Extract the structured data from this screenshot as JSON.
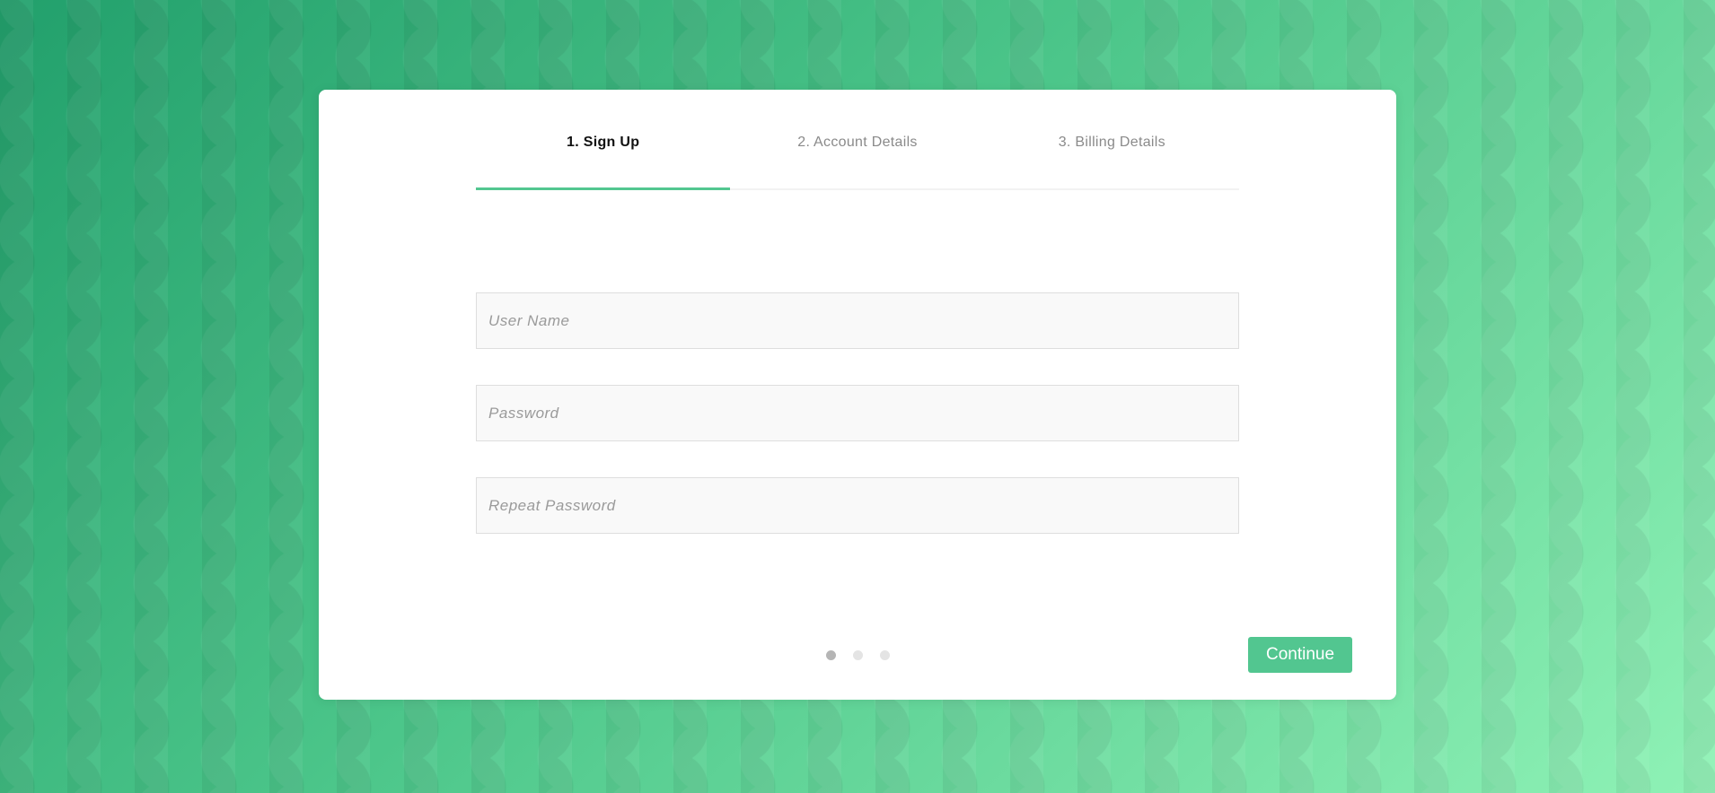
{
  "background": {
    "gradient_start": "#22a06c",
    "gradient_end": "#8ff2b6"
  },
  "accent_color": "#52c690",
  "tabs": [
    {
      "label": "1. Sign Up",
      "active": true
    },
    {
      "label": "2. Account Details",
      "active": false
    },
    {
      "label": "3. Billing Details",
      "active": false
    }
  ],
  "form": {
    "username": {
      "value": "",
      "placeholder": "User Name"
    },
    "password": {
      "value": "",
      "placeholder": "Password"
    },
    "repeat_password": {
      "value": "",
      "placeholder": "Repeat Password"
    }
  },
  "pagination": {
    "total_steps": 3,
    "current_step": 1
  },
  "continue_label": "Continue"
}
